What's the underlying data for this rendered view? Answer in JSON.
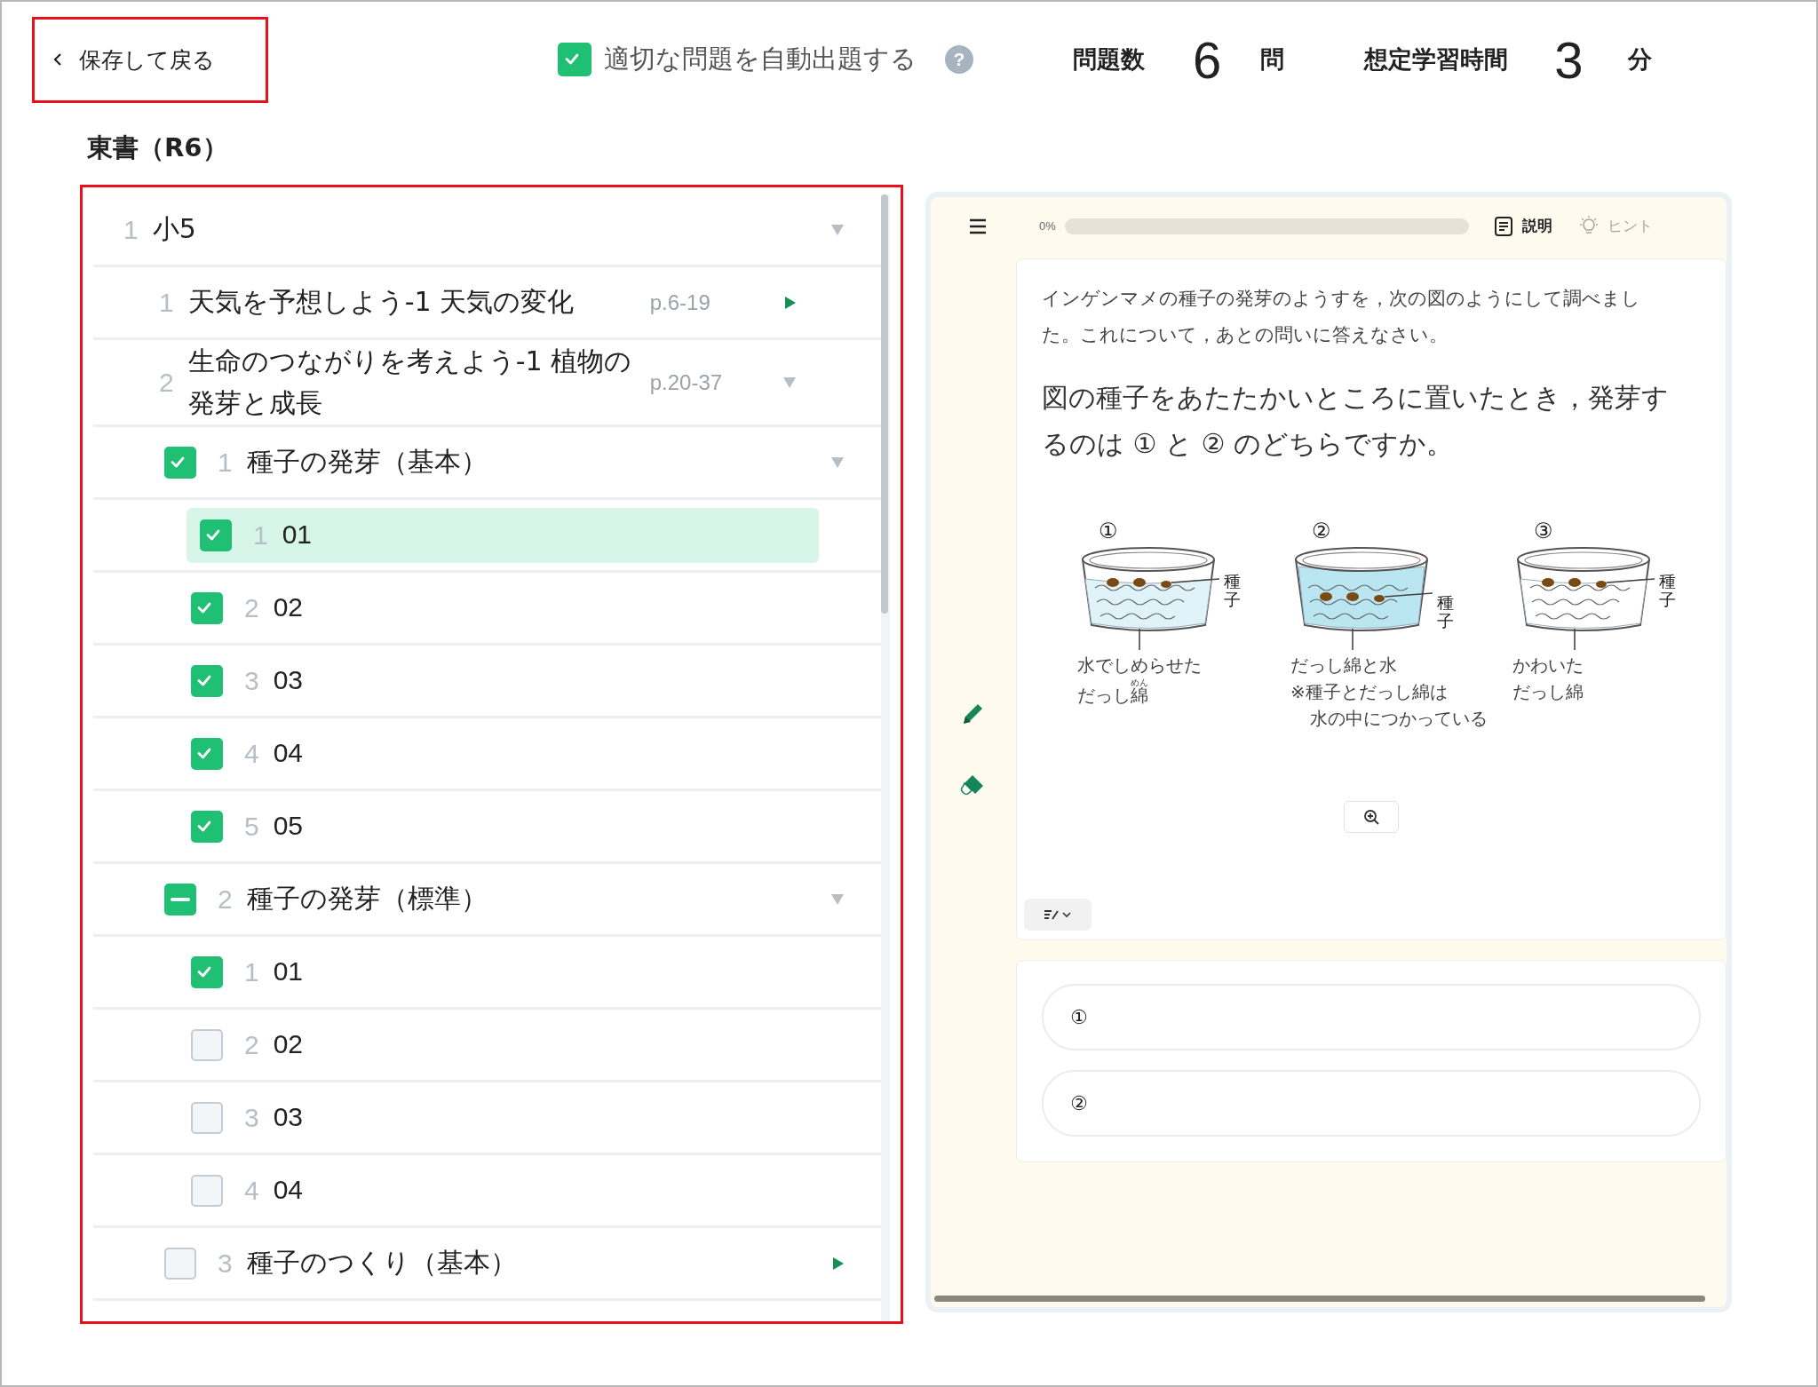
{
  "header": {
    "back_button": "保存して戻る",
    "auto_select": {
      "label": "適切な問題を自動出題する",
      "checked": true
    },
    "help": "?",
    "question_count": {
      "label": "問題数",
      "value": "6",
      "unit": "問"
    },
    "study_time": {
      "label": "想定学習時間",
      "value": "3",
      "unit": "分"
    }
  },
  "textbook_title": "東書（R6）",
  "tree": [
    {
      "number": "1",
      "label": "小5",
      "expanded": true,
      "children": [
        {
          "number": "1",
          "label": "天気を予想しよう-1 天気の変化",
          "pages": "p.6-19",
          "expanded": false
        },
        {
          "number": "2",
          "label": "生命のつながりを考えよう-1 植物の発芽と成長",
          "pages": "p.20-37",
          "expanded": true,
          "children": [
            {
              "number": "1",
              "label": "種子の発芽（基本）",
              "checked": true,
              "indeterminate": false,
              "expanded": true,
              "children": [
                {
                  "number": "1",
                  "label": "01",
                  "checked": true,
                  "selected": true
                },
                {
                  "number": "2",
                  "label": "02",
                  "checked": true,
                  "selected": false
                },
                {
                  "number": "3",
                  "label": "03",
                  "checked": true,
                  "selected": false
                },
                {
                  "number": "4",
                  "label": "04",
                  "checked": true,
                  "selected": false
                },
                {
                  "number": "5",
                  "label": "05",
                  "checked": true,
                  "selected": false
                }
              ]
            },
            {
              "number": "2",
              "label": "種子の発芽（標準）",
              "checked": false,
              "indeterminate": true,
              "expanded": true,
              "children": [
                {
                  "number": "1",
                  "label": "01",
                  "checked": true,
                  "selected": false
                },
                {
                  "number": "2",
                  "label": "02",
                  "checked": false,
                  "selected": false
                },
                {
                  "number": "3",
                  "label": "03",
                  "checked": false,
                  "selected": false
                },
                {
                  "number": "4",
                  "label": "04",
                  "checked": false,
                  "selected": false
                }
              ]
            },
            {
              "number": "3",
              "label": "種子のつくり（基本）",
              "checked": false,
              "indeterminate": false,
              "expanded": false
            }
          ]
        }
      ]
    }
  ],
  "question_panel": {
    "progress": {
      "label": "0%",
      "level": 0
    },
    "tools": [
      {
        "label": "説明",
        "disabled": false
      },
      {
        "label": "ヒント",
        "disabled": true
      }
    ],
    "intro": "インゲンマメの種子の発芽のようすを，次の図のようにして調べました。これについて，あとの問いに答えなさい。",
    "prompt": "図の種子をあたたかいところに置いたとき，発芽するのは ① と ② のどちらですか。",
    "figure": [
      {
        "number": "①",
        "kind": "moist",
        "seed_label": "種子",
        "caption": [
          "水でしめらせた",
          "だっし綿"
        ],
        "furigana": "めん"
      },
      {
        "number": "②",
        "kind": "water",
        "seed_label": "種子",
        "caption": [
          "だっし綿と水",
          "※種子とだっし綿は",
          "水の中につかっている"
        ]
      },
      {
        "number": "③",
        "kind": "dry",
        "seed_label": "種子",
        "caption": [
          "かわいた",
          "だっし綿"
        ]
      }
    ],
    "options": [
      "①",
      "②"
    ]
  }
}
